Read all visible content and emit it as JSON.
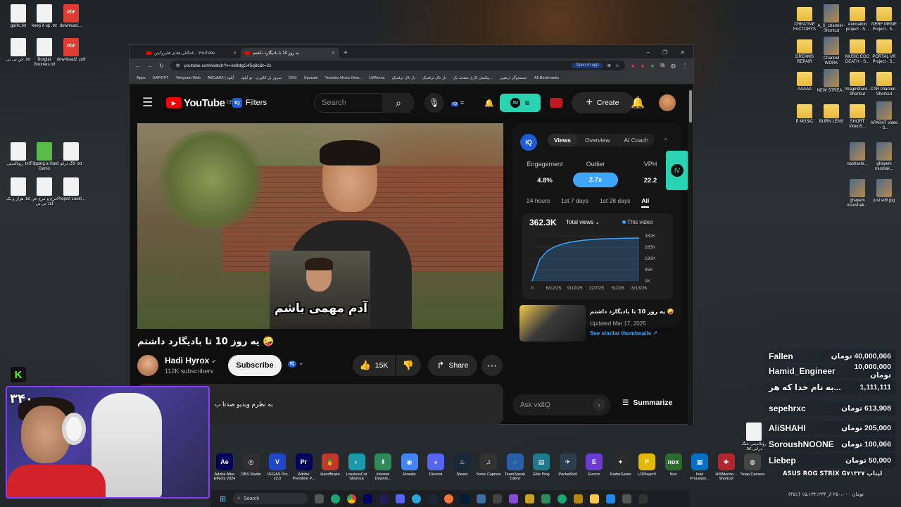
{
  "desktop": {
    "left_icons": [
      {
        "label": "garlic.txt",
        "kind": "file"
      },
      {
        "label": "keep it up .txt",
        "kind": "file"
      },
      {
        "label": "download....",
        "kind": "pdf"
      },
      {
        "label": "خن تی تی .txt",
        "kind": "file"
      },
      {
        "label": "Burglar Gnomes.txt",
        "kind": "file"
      },
      {
        "label": "download2 .pdf",
        "kind": "pdf"
      },
      {
        "label": "رونالدینی .txt",
        "kind": "file"
      },
      {
        "label": "Flipping a Hard Demo",
        "kind": "green"
      },
      {
        "label": "لاگ درآم .txt",
        "kind": "file"
      },
      {
        "label": "هزار و یک .txt",
        "kind": "file"
      },
      {
        "label": "عرج و مرج خن تی تی .txt",
        "kind": "file"
      },
      {
        "label": "Project Lookl...",
        "kind": "file"
      }
    ],
    "right_icons": [
      {
        "label": "CREATIVE FACTORYS",
        "kind": "folder"
      },
      {
        "label": "A_S_channel - Shortcut",
        "kind": "thumb"
      },
      {
        "label": "Animation project - S...",
        "kind": "folder"
      },
      {
        "label": "NERF MEME Project - S...",
        "kind": "folder"
      },
      {
        "label": "DREAMS REPAIR",
        "kind": "folder"
      },
      {
        "label": "Channel WORK",
        "kind": "thumb"
      },
      {
        "label": "MUSIC EGO DEATH - S...",
        "kind": "folder"
      },
      {
        "label": "PORTAL VR Project - S...",
        "kind": "folder"
      },
      {
        "label": "AAAAA",
        "kind": "folder"
      },
      {
        "label": "NEW STREA...",
        "kind": "thumb"
      },
      {
        "label": "ImageShare - Shortcut",
        "kind": "folder"
      },
      {
        "label": "CAR channel - Shortcut",
        "kind": "folder"
      },
      {
        "label": "P MUSIC",
        "kind": "folder"
      },
      {
        "label": "BURN LENS",
        "kind": "folder"
      },
      {
        "label": "SHORT VideoS...",
        "kind": "folder"
      },
      {
        "label": "APARAT video - S...",
        "kind": "thumb"
      },
      {
        "label": "nashashr...",
        "kind": "thumb"
      },
      {
        "label": "ghayem mushak...",
        "kind": "thumb"
      },
      {
        "label": "ghayem moushak...",
        "kind": "thumb"
      },
      {
        "label": "just edit.jpg",
        "kind": "thumb"
      }
    ],
    "bottom_right_file": "رونالدینی خنگ .txt درایی"
  },
  "browser": {
    "tabs": [
      {
        "label": "ناتنگتان هادی هایروکس - YouTube",
        "active": false
      },
      {
        "label": "یه روز 10 تا بادیگارد داشتم",
        "active": true
      }
    ],
    "new_tab": "+",
    "window_controls": [
      "–",
      "❐",
      "✕"
    ],
    "url": "youtube.com/watch?v=se8dgG45q8c&t=2s",
    "open_in_app": "Open in app",
    "bookmarks": [
      "Apps",
      "GAPGPT",
      "Telegram Web",
      "AllCaMIX | آپلود",
      "سرور بل کالیری - نو آپلود",
      "DNS",
      "Upscale",
      "Youtube Music Dow...",
      "LMArena",
      "باز ناک ترفدیک",
      "باز ناک ترفدیک",
      "پیکسل کاری صفحه بک...",
      "جستجوگر ذرهبین",
      "All Bookmarks"
    ]
  },
  "youtube": {
    "logo": "YouTube",
    "country": "DE",
    "filters": "Filters",
    "search_placeholder": "Search",
    "create": "Create",
    "video": {
      "title": "یه روز 10 تا بادیگارد داشتم 🤪",
      "caption": "آدم مهمی باشم",
      "channel": "Hadi Hyrox",
      "subscribers": "112K subscribers",
      "subscribe": "Subscribe",
      "likes": "15K",
      "share": "Share",
      "comment_preview": "به نظرم ویدیو صدتا ب"
    },
    "vidiq": {
      "logo": "IQ",
      "tabs": [
        "Views",
        "Overview",
        "AI Coach"
      ],
      "metrics": [
        {
          "label": "Engagement",
          "value": "4.8%"
        },
        {
          "label": "Outlier",
          "value": "2.7x"
        },
        {
          "label": "VPH",
          "value": "22.2"
        }
      ],
      "ranges": [
        "24 hours",
        "1st 7 days",
        "1st 28 days",
        "All"
      ],
      "total_value": "362.3K",
      "total_select": "Total views",
      "legend": "This video",
      "legend_color": "#3ea6ff",
      "y_ticks": [
        "380K",
        "285K",
        "190K",
        "95K",
        "0K"
      ],
      "x_ticks": [
        "0",
        "6/12/25",
        "9/10/25",
        "12/7/25",
        "5/2/26",
        "8/13/26"
      ],
      "thumb_title": "یه روز 10 تا بادیگارد داشتم 🤪",
      "updated": "Updated Mar 17, 2025",
      "similar": "See similar thumbnails ↗",
      "ask_placeholder": "Ask vidIQ",
      "summarize": "Summarize"
    }
  },
  "chart_data": {
    "type": "area",
    "y_label": "",
    "series": [
      {
        "values": [
          0,
          180,
          255,
          290,
          312,
          328,
          338,
          345,
          350,
          354,
          356,
          358,
          360,
          361,
          362.3
        ]
      }
    ],
    "ylim": [
      0,
      380
    ]
  },
  "donations": [
    {
      "name": "Fallen",
      "amount": "40,000,066 تومان"
    },
    {
      "name": "Hamid_Engineer",
      "amount": "10,000,000 تومان"
    },
    {
      "name": "به نام خدا که هر...",
      "amount": "1,111,111"
    },
    {
      "name": "sepehrxc",
      "amount": "613,908 تومان"
    },
    {
      "name": "AliSHAHI",
      "amount": "205,000 تومان"
    },
    {
      "name": "SoroushNOONE",
      "amount": "100,066 تومان"
    },
    {
      "name": "Liebep",
      "amount": "50,000 تومان"
    }
  ],
  "stream": {
    "webcam_counter": "۳۴۰",
    "logo": "K",
    "laptop_label": "ASUS ROG STRIX G۷۱۳۲۷ لپتاپ",
    "laptop_price": "(۴۵٪) تومان ۲۵۰،۰۰۰ از ۱۵،۱۳۲،۲۳۴"
  },
  "dock_apps": [
    {
      "label": "Adobe After Effects 2024",
      "color": "#00005b",
      "glyph": "Ae"
    },
    {
      "label": "OBS Studio",
      "color": "#302e31",
      "glyph": "◎"
    },
    {
      "label": "VEGAS Pro 22.0",
      "color": "#2047c7",
      "glyph": "V"
    },
    {
      "label": "Adobe Premiere P...",
      "color": "#00005b",
      "glyph": "Pr"
    },
    {
      "label": "HandBrake",
      "color": "#c0392b",
      "glyph": "🍍"
    },
    {
      "label": "LosslessCut Shortcut",
      "color": "#1b9aaa",
      "glyph": "◐"
    },
    {
      "label": "Internet Downlo...",
      "color": "#2e8b57",
      "glyph": "⬇"
    },
    {
      "label": "Rosalie",
      "color": "#4285f4",
      "glyph": "◉"
    },
    {
      "label": "Discord",
      "color": "#5865f2",
      "glyph": "◕"
    },
    {
      "label": "Steam",
      "color": "#1b2838",
      "glyph": "♨"
    },
    {
      "label": "Sonic Capture",
      "color": "#333",
      "glyph": "♫"
    },
    {
      "label": "TeamSpeak Client",
      "color": "#2a5fa8",
      "glyph": "◌"
    },
    {
      "label": "Elite Ping",
      "color": "#1f7a8c",
      "glyph": "▤"
    },
    {
      "label": "PacketRoll",
      "color": "#2c3e50",
      "glyph": "✈"
    },
    {
      "label": "Electro",
      "color": "#6c3bd1",
      "glyph": "E"
    },
    {
      "label": "RadarGame",
      "color": "#2b2b2b",
      "glyph": "✦"
    },
    {
      "label": "LDPlayer9",
      "color": "#e5b800",
      "glyph": "P"
    },
    {
      "label": "Nox",
      "color": "#2d6a2d",
      "glyph": "nox"
    },
    {
      "label": "Intel Processo...",
      "color": "#0071c5",
      "glyph": "▦"
    },
    {
      "label": "HWMonito... Shortcut",
      "color": "#b0282e",
      "glyph": "✚"
    },
    {
      "label": "Snap Camera",
      "color": "#444",
      "glyph": "◍"
    }
  ],
  "taskbar": {
    "search": "Search"
  }
}
